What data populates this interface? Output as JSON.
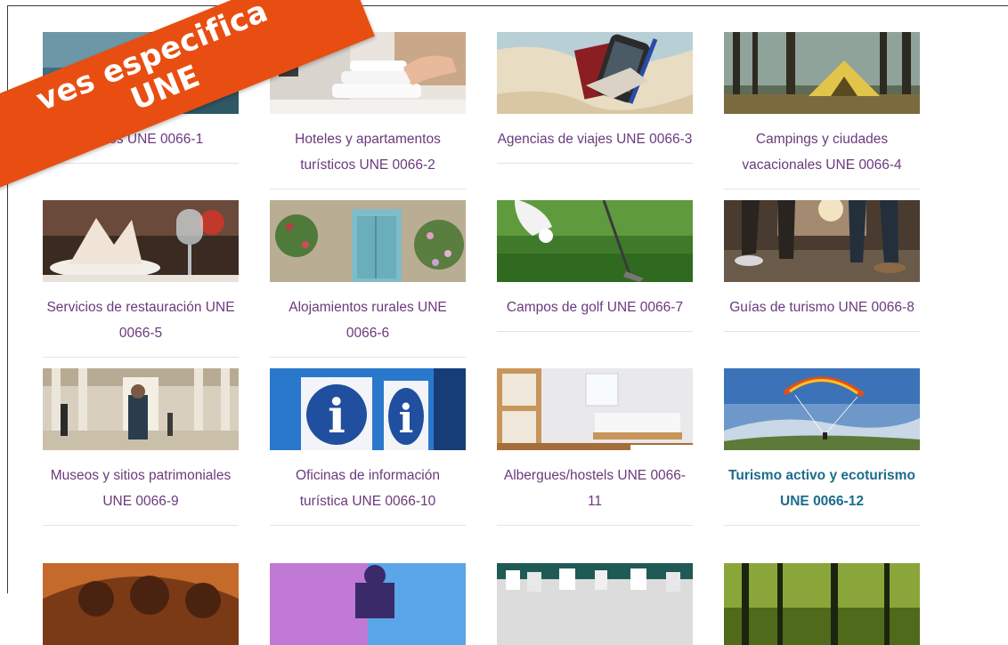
{
  "ribbon": {
    "line1": "ves especifica",
    "line2": "UNE"
  },
  "items": [
    {
      "title": "Balnearios UNE 0066-1",
      "visible_title": "nearios UNE 0066-1",
      "image": "spa-image"
    },
    {
      "title": "Hoteles y apartamentos turísticos UNE 0066-2",
      "image": "towels-image"
    },
    {
      "title": "Agencias de viajes UNE 0066-3",
      "image": "map-passport-image"
    },
    {
      "title": "Campings y ciudades vacacionales UNE 0066-4",
      "image": "tent-forest-image"
    },
    {
      "title": "Servicios de restauración UNE 0066-5",
      "image": "restaurant-table-image"
    },
    {
      "title": "Alojamientos rurales UNE 0066-6",
      "image": "blue-door-flowers-image"
    },
    {
      "title": "Campos de golf UNE 0066-7",
      "image": "golf-image"
    },
    {
      "title": "Guías de turismo UNE 0066-8",
      "image": "walking-street-image"
    },
    {
      "title": "Museos y sitios patrimoniales UNE 0066-9",
      "image": "museum-hall-image"
    },
    {
      "title": "Oficinas de información turística UNE 0066-10",
      "image": "info-sign-image"
    },
    {
      "title": "Albergues/hostels UNE 0066-11",
      "image": "hostel-room-image"
    },
    {
      "title": "Turismo activo y ecoturismo UNE 0066-12",
      "image": "paragliding-image"
    },
    {
      "title": "",
      "image": "wine-barrels-image"
    },
    {
      "title": "",
      "image": "festival-stage-image"
    },
    {
      "title": "",
      "image": "town-facades-image"
    },
    {
      "title": "",
      "image": "green-forest-image"
    }
  ]
}
